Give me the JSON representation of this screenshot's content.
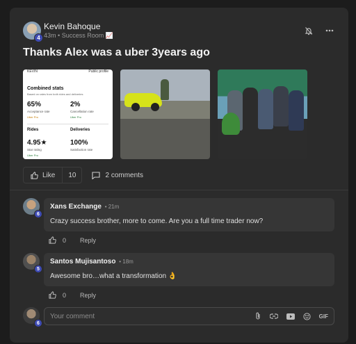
{
  "post": {
    "author": "Kevin Bahoque",
    "author_level": "4",
    "time": "43m",
    "separator": "•",
    "room": "Success Room",
    "room_emoji": "📈",
    "title": "Thanks Alex was a uber 3years ago"
  },
  "stats_image": {
    "top_left": "KEVIN",
    "top_right": "Public profile",
    "heading": "Combined stats",
    "subheading": "Based on rates from both rides and deliveries",
    "acceptance_value": "65%",
    "acceptance_label": "Acceptance rate",
    "acceptance_badge": "Uber Pro",
    "cancel_value": "2%",
    "cancel_label": "Cancellation rate",
    "cancel_badge": "Uber Pro",
    "rides_label": "Rides",
    "deliveries_label": "Deliveries",
    "star_value": "4.95★",
    "star_label": "Star rating",
    "star_badge": "Uber Pro",
    "satisfaction_value": "100%",
    "satisfaction_label": "Satisfaction rate"
  },
  "actions": {
    "like_label": "Like",
    "like_count": "10",
    "comments_label": "2 comments"
  },
  "comments": [
    {
      "name": "Xans Exchange",
      "level": "6",
      "time": "• 21m",
      "text": "Crazy success brother, more to come. Are you a full time trader now?",
      "likes": "0",
      "reply_label": "Reply"
    },
    {
      "name": "Santos Mujisantoso",
      "level": "5",
      "time": "• 18m",
      "text": "Awesome bro…what a transformation 👌",
      "likes": "0",
      "reply_label": "Reply"
    }
  ],
  "composer": {
    "level": "6",
    "placeholder": "Your comment",
    "gif_label": "GIF"
  },
  "colors": {
    "modal_bg": "#2b2b2b",
    "bubble_bg": "#363636",
    "level_badge": "#3e4bb5",
    "accent_car": "#d6e21a"
  }
}
